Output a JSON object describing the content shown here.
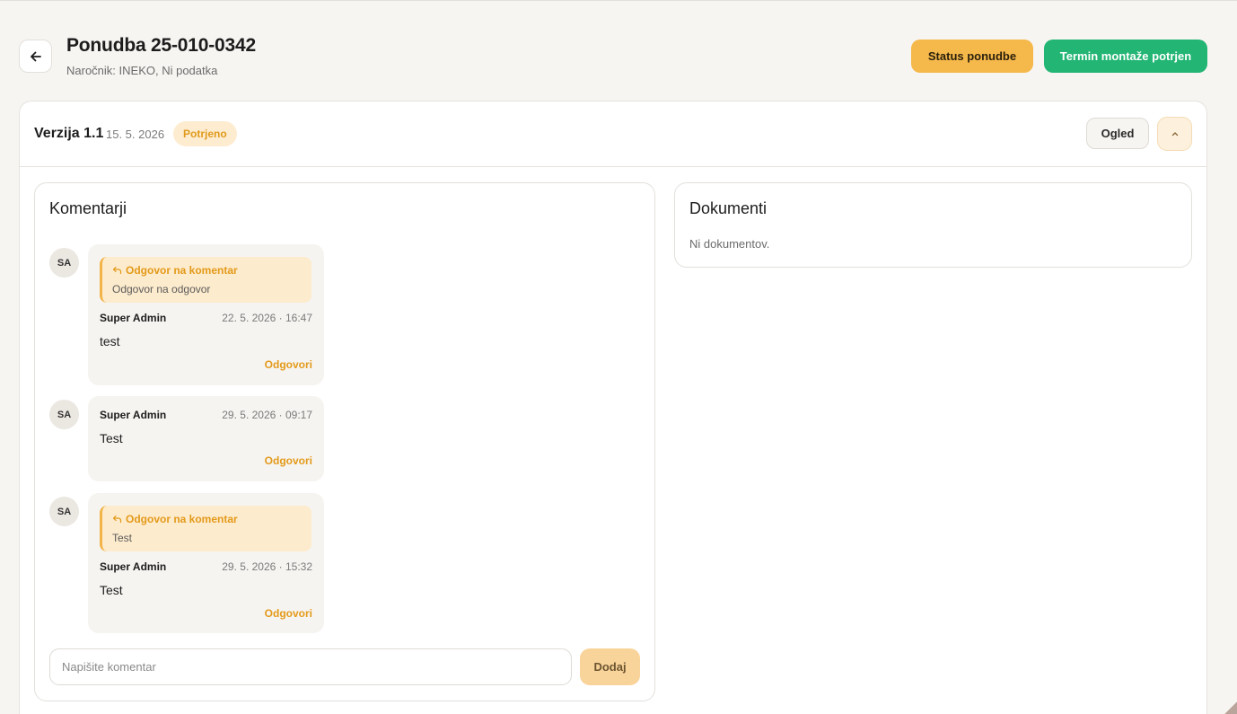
{
  "header": {
    "back_icon": "arrow-left-icon",
    "title": "Ponudba 25-010-0342",
    "subtitle": "Naročnik: INEKO, Ni podatka",
    "status_button": "Status ponudbe",
    "termin_button": "Termin montaže potrjen",
    "colors": {
      "status": "#f5b84a",
      "termin": "#22b573"
    }
  },
  "version": {
    "title": "Verzija 1.1",
    "date": "15. 5. 2026",
    "badge": "Potrjeno",
    "ogled_button": "Ogled",
    "collapse_icon": "chevron-up-icon"
  },
  "comments_panel": {
    "title": "Komentarji",
    "items": [
      {
        "avatar": "SA",
        "has_quote": true,
        "quote_label": "Odgovor na komentar",
        "quote_text": "Odgovor na odgovor",
        "author": "Super Admin",
        "time": "22. 5. 2026 · 16:47",
        "text": "test",
        "reply": "Odgovori"
      },
      {
        "avatar": "SA",
        "has_quote": false,
        "author": "Super Admin",
        "time": "29. 5. 2026 · 09:17",
        "text": "Test",
        "reply": "Odgovori"
      },
      {
        "avatar": "SA",
        "has_quote": true,
        "quote_label": "Odgovor na komentar",
        "quote_text": "Test",
        "author": "Super Admin",
        "time": "29. 5. 2026 · 15:32",
        "text": "Test",
        "reply": "Odgovori"
      }
    ],
    "input_placeholder": "Napišite komentar",
    "add_button": "Dodaj"
  },
  "documents_panel": {
    "title": "Dokumenti",
    "empty_text": "Ni dokumentov."
  }
}
